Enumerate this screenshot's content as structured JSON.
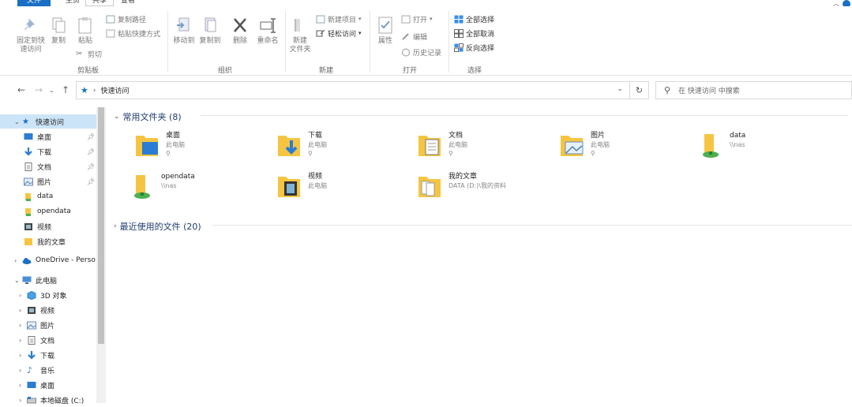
{
  "menu": {
    "file": "文件",
    "home": "主页",
    "share": "共享",
    "view": "查看"
  },
  "ribbon": {
    "pin_quick": "固定到快\n速访问",
    "copy": "复制",
    "paste": "粘贴",
    "copy_path": "复制路径",
    "paste_shortcut": "粘贴快捷方式",
    "cut": "剪切",
    "group_clipboard": "剪贴板",
    "move_to": "移动到",
    "copy_to": "复制到",
    "delete": "删除",
    "rename": "重命名",
    "group_organize": "组织",
    "new_folder": "新建\n文件夹",
    "new_item": "新建项目",
    "easy_access": "轻松访问",
    "group_new": "新建",
    "properties": "属性",
    "open": "打开",
    "edit": "编辑",
    "history": "历史记录",
    "group_open": "打开",
    "select_all": "全部选择",
    "select_none": "全部取消",
    "invert_select": "反向选择",
    "group_select": "选择"
  },
  "address": {
    "crumb": "快速访问",
    "search_placeholder": "在 快速访问 中搜索"
  },
  "sidebar": {
    "items": [
      {
        "label": "快速访问",
        "icon": "star-icon"
      },
      {
        "label": "桌面",
        "icon": "desktop-icon"
      },
      {
        "label": "下载",
        "icon": "download-icon"
      },
      {
        "label": "文档",
        "icon": "document-icon"
      },
      {
        "label": "图片",
        "icon": "picture-icon"
      },
      {
        "label": "data",
        "icon": "folder-icon"
      },
      {
        "label": "opendata",
        "icon": "folder-icon"
      },
      {
        "label": "视频",
        "icon": "video-icon"
      },
      {
        "label": "我的文章",
        "icon": "folder-icon"
      },
      {
        "label": "OneDrive - Perso",
        "icon": "cloud-icon"
      },
      {
        "label": "此电脑",
        "icon": "computer-icon"
      },
      {
        "label": "3D 对象",
        "icon": "cube-icon"
      },
      {
        "label": "视频",
        "icon": "video-icon"
      },
      {
        "label": "图片",
        "icon": "picture-icon"
      },
      {
        "label": "文档",
        "icon": "document-icon"
      },
      {
        "label": "下载",
        "icon": "download-icon"
      },
      {
        "label": "音乐",
        "icon": "music-icon"
      },
      {
        "label": "桌面",
        "icon": "desktop-icon"
      },
      {
        "label": "本地磁盘 (C:)",
        "icon": "drive-icon"
      }
    ]
  },
  "content": {
    "frequent_header": "常用文件夹 (8)",
    "recent_header": "最近使用的文件 (20)",
    "folders": [
      {
        "name": "桌面",
        "sub": "此电脑",
        "pinned": true,
        "icon": "desktop-folder-icon"
      },
      {
        "name": "下载",
        "sub": "此电脑",
        "pinned": true,
        "icon": "download-folder-icon"
      },
      {
        "name": "文档",
        "sub": "此电脑",
        "pinned": true,
        "icon": "document-folder-icon"
      },
      {
        "name": "图片",
        "sub": "此电脑",
        "pinned": true,
        "icon": "picture-folder-icon"
      },
      {
        "name": "data",
        "sub": "\\\\nas",
        "pinned": false,
        "icon": "network-folder-icon"
      },
      {
        "name": "opendata",
        "sub": "\\\\nas",
        "pinned": false,
        "icon": "network-folder-icon"
      },
      {
        "name": "视频",
        "sub": "此电脑",
        "pinned": false,
        "icon": "video-folder-icon"
      },
      {
        "name": "我的文章",
        "sub": "DATA (D:)\\我的资料",
        "pinned": false,
        "icon": "article-folder-icon"
      }
    ]
  },
  "colors": {
    "accent": "#1a6fc4",
    "folder": "#f5c542",
    "selection": "#cce4f7"
  }
}
